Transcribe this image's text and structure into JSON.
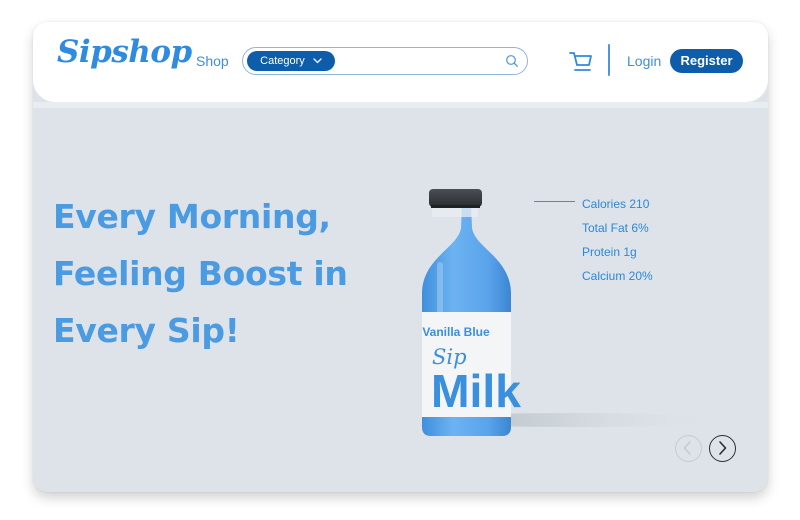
{
  "header": {
    "logo_text": "Sipshop",
    "nav_shop": "Shop",
    "category_label": "Category",
    "login_label": "Login",
    "register_label": "Register"
  },
  "hero": {
    "lines": [
      "Every Morning,",
      "Feeling Boost in",
      "Every Sip!"
    ]
  },
  "product": {
    "flavor": "Vanilla Blue",
    "brand_small": "Sip",
    "brand_large": "Milk",
    "nutrition": [
      "Calories 210",
      "Total Fat 6%",
      "Protein 1g",
      "Calcium 20%"
    ]
  },
  "colors": {
    "brand_blue": "#2f8be0",
    "button_dark_blue": "#0d5dab",
    "hero_background": "#dde3e8",
    "milk_blue": "#5aa6ec"
  },
  "icons": [
    "chevron-down-icon",
    "search-icon",
    "cart-icon",
    "chevron-left-icon",
    "chevron-right-icon"
  ]
}
